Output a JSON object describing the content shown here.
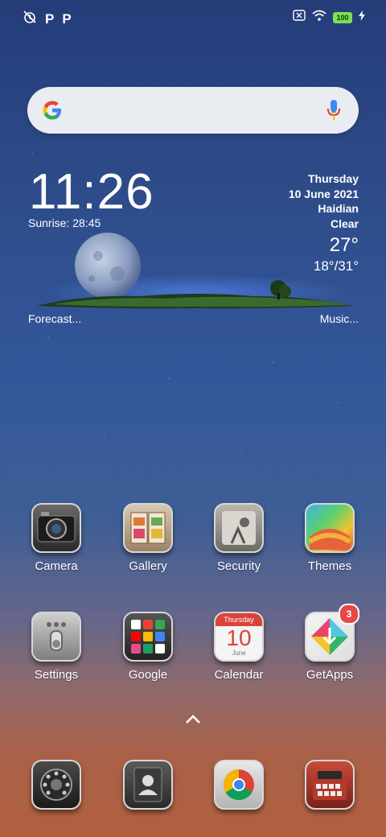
{
  "status_bar": {
    "left_icons": [
      "alarm-off-icon",
      "p-icon",
      "p-icon"
    ],
    "p_label": "P",
    "battery": "100",
    "right_icons": [
      "sim-off-icon",
      "wifi-icon",
      "battery-icon",
      "charging-icon"
    ]
  },
  "search": {
    "icons": [
      "google-g-icon",
      "microphone-icon"
    ]
  },
  "clock_widget": {
    "time": "11:26",
    "sunrise": "Sunrise: 28:45",
    "day": "Thursday",
    "date": "10 June 2021",
    "location": "Haidian",
    "condition": "Clear",
    "temperature": "27°",
    "range": "18°/31°",
    "forecast_link": "Forecast...",
    "music_link": "Music..."
  },
  "apps_row1": [
    {
      "label": "Camera",
      "icon": "camera-icon"
    },
    {
      "label": "Gallery",
      "icon": "gallery-icon"
    },
    {
      "label": "Security",
      "icon": "security-icon"
    },
    {
      "label": "Themes",
      "icon": "themes-icon"
    }
  ],
  "apps_row2": [
    {
      "label": "Settings",
      "icon": "settings-icon"
    },
    {
      "label": "Google",
      "icon": "google-folder-icon"
    },
    {
      "label": "Calendar",
      "icon": "calendar-icon",
      "day": "Thursday",
      "date": "10",
      "month": "June"
    },
    {
      "label": "GetApps",
      "icon": "getapps-icon",
      "badge": "3"
    }
  ],
  "dock": [
    {
      "icon": "phone-icon"
    },
    {
      "icon": "contacts-icon"
    },
    {
      "icon": "chrome-icon"
    },
    {
      "icon": "messaging-icon"
    }
  ],
  "drawer_icon": "chevron-up-icon"
}
